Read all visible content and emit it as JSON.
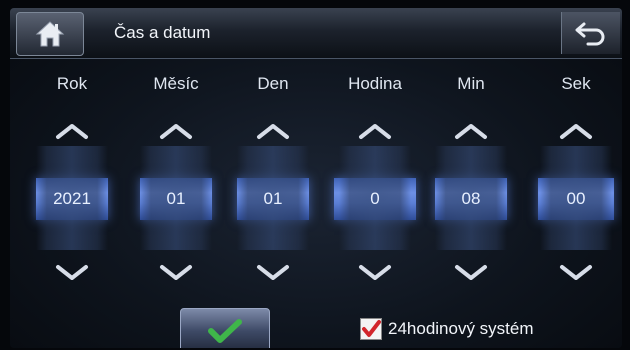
{
  "header": {
    "title": "Čas a datum",
    "home_icon": "home-icon",
    "back_icon": "back-arrow-icon"
  },
  "columns": [
    {
      "label": "Rok",
      "value": "2021"
    },
    {
      "label": "Měsíc",
      "value": "01"
    },
    {
      "label": "Den",
      "value": "01"
    },
    {
      "label": "Hodina",
      "value": "0"
    },
    {
      "label": "Min",
      "value": "08"
    },
    {
      "label": "Sek",
      "value": "00"
    }
  ],
  "footer": {
    "confirm_icon": "checkmark-icon",
    "format_option": {
      "label": "24hodinový systém",
      "checked": true
    }
  },
  "colors": {
    "accent": "#5b7fd6",
    "confirm_check": "#3fb64a",
    "checkbox_mark": "#d2262c"
  }
}
